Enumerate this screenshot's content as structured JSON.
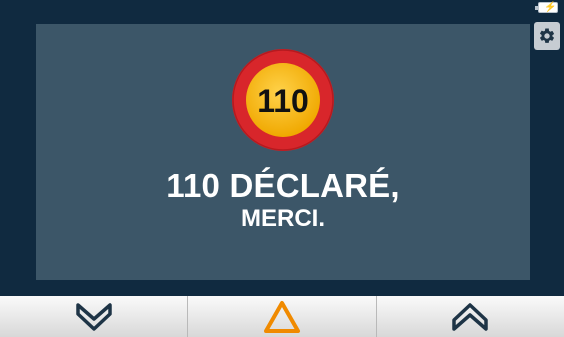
{
  "sign": {
    "code": "110",
    "ring_color": "#d8262b",
    "fill_color": "#f6b400"
  },
  "message": {
    "line1": "110 DÉCLARÉ,",
    "line2": "MERCI."
  },
  "status": {
    "battery_icon": "battery-charging-icon"
  },
  "toolbar": {
    "left_icon": "chevron-down-icon",
    "center_icon": "warning-triangle-icon",
    "right_icon": "chevron-up-icon",
    "accent": "#f08a00"
  }
}
